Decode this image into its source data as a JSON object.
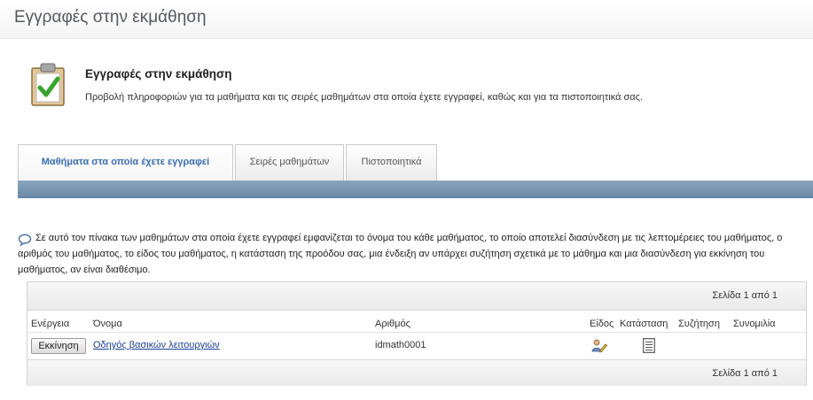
{
  "page": {
    "title": "Εγγραφές στην εκμάθηση"
  },
  "section": {
    "heading": "Εγγραφές στην εκμάθηση",
    "description": "Προβολή πληροφοριών για τα μαθήματα και τις σειρές μαθημάτων στα οποία έχετε εγγραφεί, καθώς και για τα πιστοποιητικά σας.",
    "icon": "clipboard-checkmark-icon"
  },
  "tabs": [
    {
      "label": "Μαθήματα στα οποία έχετε εγγραφεί",
      "active": true
    },
    {
      "label": "Σειρές μαθημάτων",
      "active": false
    },
    {
      "label": "Πιστοποιητικά",
      "active": false
    }
  ],
  "info": {
    "icon": "speech-bubble-icon",
    "text": "Σε αυτό τον πίνακα των μαθημάτων στα οποία έχετε εγγραφεί εμφανίζεται το όνομα του κάθε μαθήματος, το οποίο αποτελεί διασύνδεση με τις λεπτομέρειες του μαθήματος, ο αριθμός του μαθήματος, το είδος του μαθήματος, η κατάσταση της προόδου σας, μια ένδειξη αν υπάρχει συζήτηση σχετικά με το μάθημα και μια διασύνδεση για εκκίνηση του μαθήματος, αν είναι διαθέσιμο."
  },
  "table": {
    "pager_top": "Σελίδα 1 από 1",
    "pager_bottom": "Σελίδα 1 από 1",
    "columns": {
      "action": "Ενέργεια",
      "name": "Όνομα",
      "number": "Αριθμός",
      "type": "Είδος",
      "status": "Κατάσταση",
      "discussion": "Συζήτηση",
      "chat": "Συνομιλία"
    },
    "rows": [
      {
        "action_label": "Εκκίνηση",
        "name": "Οδηγός βασικών λειτουργιών",
        "number": "idmath0001",
        "type_icon": "people-pencil-icon",
        "status_icon": "document-list-icon"
      }
    ]
  },
  "colors": {
    "tab_active_text": "#3b6db3",
    "link": "#1a3f99",
    "tab_strip": "#7590ab"
  }
}
